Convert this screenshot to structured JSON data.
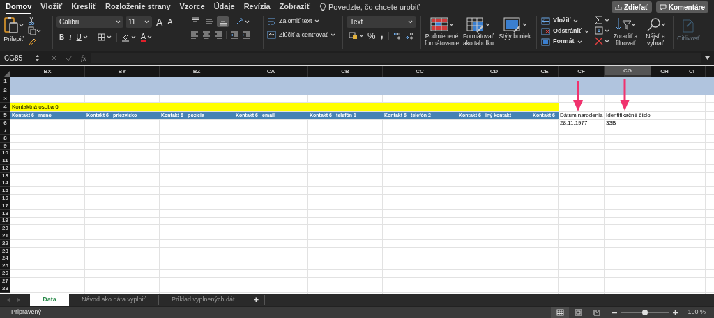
{
  "menu_tabs": [
    {
      "label": "Domov",
      "selected": true
    },
    {
      "label": "Vložiť",
      "selected": false
    },
    {
      "label": "Kresliť",
      "selected": false
    },
    {
      "label": "Rozloženie strany",
      "selected": false
    },
    {
      "label": "Vzorce",
      "selected": false
    },
    {
      "label": "Údaje",
      "selected": false
    },
    {
      "label": "Revízia",
      "selected": false
    },
    {
      "label": "Zobraziť",
      "selected": false
    }
  ],
  "tell_me": {
    "placeholder": "Povedzte, čo chcete urobiť"
  },
  "share_button": "Zdieľať",
  "comments_button": "Komentáre",
  "ribbon": {
    "paste": "Prilepiť",
    "font_name": "Calibri",
    "size_dropdown": "11",
    "grow_font": "A",
    "shrink_font": "A",
    "bold": "B",
    "italic": "I",
    "underline": "U",
    "font_color": "A",
    "vertical_align": [
      {
        "kind": "top",
        "selected": false
      },
      {
        "kind": "middle",
        "selected": false
      },
      {
        "kind": "bottom",
        "selected": true
      }
    ],
    "wrap_text": "Zalomiť text",
    "merge_center": "Zlúčiť a centrovať",
    "number_format": "Text",
    "percent": "%",
    "comma": ",",
    "styles": [
      {
        "label": "Podmienené formátovanie",
        "kind": "conditional"
      },
      {
        "label": "Formátovať ako tabuľku",
        "kind": "table"
      },
      {
        "label": "Štýly buniek",
        "kind": "cell_styles"
      }
    ],
    "cells": [
      {
        "label": "Vložiť",
        "kind": "insert"
      },
      {
        "label": "Odstrániť",
        "kind": "delete"
      },
      {
        "label": "Formát",
        "kind": "format"
      }
    ],
    "editing": [
      {
        "label": "Zoradiť a filtrovať",
        "kind": "sort"
      },
      {
        "label": "Nájsť a vybrať",
        "kind": "find"
      }
    ],
    "sensitivity": {
      "label": "Citlivosť",
      "disabled": true
    }
  },
  "formula_bar": {
    "name_box": "CG85",
    "function_label": "fx"
  },
  "sheet": {
    "columns": [
      {
        "label": "BX",
        "selected": false
      },
      {
        "label": "BY",
        "selected": false
      },
      {
        "label": "BZ",
        "selected": false
      },
      {
        "label": "CA",
        "selected": false
      },
      {
        "label": "CB",
        "selected": false
      },
      {
        "label": "CC",
        "selected": false
      },
      {
        "label": "CD",
        "selected": false
      },
      {
        "label": "CE",
        "selected": false
      },
      {
        "label": "CF",
        "selected": false
      },
      {
        "label": "CG",
        "selected": true
      },
      {
        "label": "CH",
        "selected": false
      },
      {
        "label": "CI",
        "selected": false
      }
    ],
    "rows": [
      {
        "number": "1",
        "kind": "band"
      },
      {
        "number": "2",
        "kind": "band"
      },
      {
        "number": "3",
        "kind": "plain"
      },
      {
        "number": "4",
        "kind": "banner",
        "text": "Kontaktná osoba 6"
      },
      {
        "number": "5",
        "kind": "header",
        "headers": [
          "Kontakt 6 - meno",
          "Kontakt 6 - priezvisko",
          "Kontakt 6 - pozícia",
          "Kontakt 6 - email",
          "Kontakt 6 - telefón 1",
          "Kontakt 6 - telefón 2",
          "Kontakt 6 - iný kontakt",
          "Kontakt 6 -"
        ],
        "cells": [
          "Dátum narodenia",
          "Identifikačné číslo"
        ]
      },
      {
        "number": "6",
        "kind": "data",
        "cells": [
          "28.11.1977",
          "33B"
        ]
      },
      {
        "number": "7",
        "kind": "plain"
      },
      {
        "number": "8",
        "kind": "plain"
      },
      {
        "number": "9",
        "kind": "plain"
      },
      {
        "number": "10",
        "kind": "plain"
      },
      {
        "number": "11",
        "kind": "plain"
      },
      {
        "number": "12",
        "kind": "plain"
      },
      {
        "number": "13",
        "kind": "plain"
      },
      {
        "number": "14",
        "kind": "plain"
      },
      {
        "number": "15",
        "kind": "plain"
      },
      {
        "number": "16",
        "kind": "plain"
      },
      {
        "number": "17",
        "kind": "plain"
      },
      {
        "number": "18",
        "kind": "plain"
      },
      {
        "number": "19",
        "kind": "plain"
      },
      {
        "number": "20",
        "kind": "plain"
      },
      {
        "number": "21",
        "kind": "plain"
      },
      {
        "number": "22",
        "kind": "plain"
      },
      {
        "number": "23",
        "kind": "plain"
      },
      {
        "number": "24",
        "kind": "plain"
      },
      {
        "number": "25",
        "kind": "plain"
      },
      {
        "number": "26",
        "kind": "plain"
      },
      {
        "number": "27",
        "kind": "plain"
      },
      {
        "number": "28",
        "kind": "plain"
      }
    ]
  },
  "sheet_tabs": [
    {
      "label": "Data",
      "selected": true
    },
    {
      "label": "Návod ako dáta vyplniť",
      "selected": false
    },
    {
      "label": "Príklad vyplnených dát",
      "selected": false
    }
  ],
  "add_sheet": "+",
  "status_bar": {
    "status": "Pripravený",
    "views": [
      {
        "kind": "normal",
        "selected": true
      },
      {
        "kind": "page_layout",
        "selected": false
      },
      {
        "kind": "page_break",
        "selected": false
      }
    ],
    "zoom": {
      "level": 0.5
    },
    "zoom_label": "100 %"
  }
}
